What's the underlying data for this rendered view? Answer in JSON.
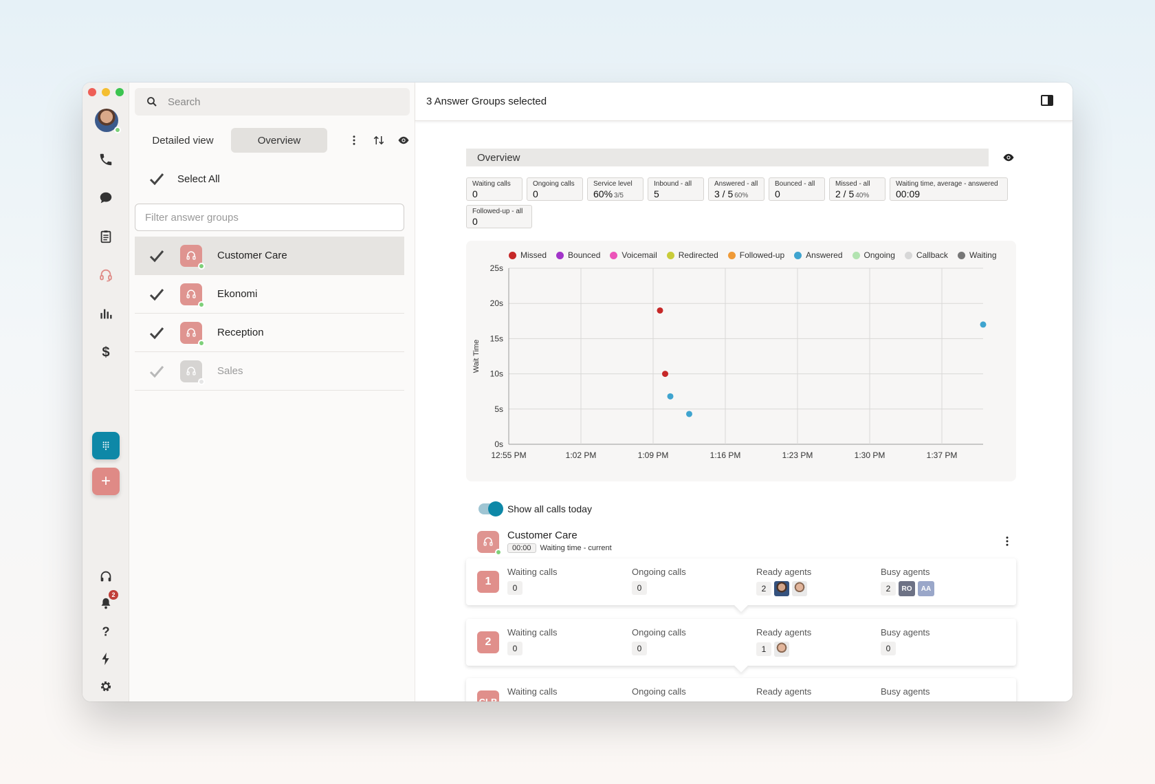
{
  "colors": {
    "red": "#ee5f56",
    "yellow": "#f4be31",
    "green": "#3cc450",
    "teal": "#0e88a7",
    "salmon": "#df9490",
    "missed": "#c62828",
    "bounced": "#a235c9",
    "voicemail": "#ec54b9",
    "redirected": "#c9cc3a",
    "followed_up": "#ef9a37",
    "answered": "#3fa4cf",
    "ongoing": "#b2e3b0",
    "callback": "#d7d7d7",
    "waiting": "#777777"
  },
  "rail": {
    "icons": [
      "phone-icon",
      "chat-icon",
      "clipboard-icon",
      "headset-group-icon",
      "bar-chart-icon",
      "dollar-icon"
    ],
    "dialpad_label": "dialpad-icon",
    "add_label": "+",
    "bottom_icons": [
      "headphones-icon",
      "bell-icon",
      "help-icon",
      "lightning-icon",
      "settings-icon"
    ],
    "notification_count": "2"
  },
  "panel": {
    "search_placeholder": "Search",
    "tabs": [
      {
        "label": "Detailed view"
      },
      {
        "label": "Overview"
      }
    ],
    "select_all": "Select All",
    "filter_placeholder": "Filter answer groups",
    "groups": [
      {
        "name": "Customer Care"
      },
      {
        "name": "Ekonomi"
      },
      {
        "name": "Reception"
      },
      {
        "name": "Sales"
      }
    ]
  },
  "main": {
    "title": "3 Answer Groups selected",
    "overview_title": "Overview",
    "stats": [
      {
        "label": "Waiting calls",
        "value": "0",
        "sub": ""
      },
      {
        "label": "Ongoing calls",
        "value": "0",
        "sub": ""
      },
      {
        "label": "Service level",
        "value": "60%",
        "sub": "3/5"
      },
      {
        "label": "Inbound - all",
        "value": "5",
        "sub": ""
      },
      {
        "label": "Answered - all",
        "value": "3 / 5",
        "sub": "60%"
      },
      {
        "label": "Bounced - all",
        "value": "0",
        "sub": ""
      },
      {
        "label": "Missed - all",
        "value": "2 / 5",
        "sub": "40%"
      },
      {
        "label": "Waiting time, average - answered",
        "value": "00:09",
        "sub": ""
      },
      {
        "label": "Followed-up - all",
        "value": "0",
        "sub": ""
      }
    ],
    "toggle_label": "Show all calls today",
    "group_name": "Customer Care",
    "wait_time": "00:00",
    "wait_label": "Waiting time - current",
    "queue_labels": {
      "waiting": "Waiting calls",
      "ongoing": "Ongoing calls",
      "ready": "Ready agents",
      "busy": "Busy agents"
    },
    "queues": [
      {
        "num": "1",
        "waiting": "0",
        "ongoing": "0",
        "ready": "2",
        "busy": "2",
        "busy_initials": [
          "RO",
          "AA"
        ]
      },
      {
        "num": "2",
        "waiting": "0",
        "ongoing": "0",
        "ready": "1",
        "busy": "0",
        "busy_initials": []
      },
      {
        "num": "CLB",
        "waiting": "",
        "ongoing": "",
        "ready": "",
        "busy": "",
        "busy_initials": []
      }
    ]
  },
  "chart_data": {
    "type": "scatter",
    "title": "",
    "xlabel": "",
    "ylabel": "Wait Time",
    "x_ticks": [
      "12:55 PM",
      "1:02 PM",
      "1:09 PM",
      "1:16 PM",
      "1:23 PM",
      "1:30 PM",
      "1:37 PM"
    ],
    "y_ticks": [
      "0s",
      "5s",
      "10s",
      "15s",
      "20s",
      "25s"
    ],
    "xlim": [
      "12:55",
      "1:41"
    ],
    "ylim": [
      0,
      25
    ],
    "grid": true,
    "legend": [
      "Missed",
      "Bounced",
      "Voicemail",
      "Redirected",
      "Followed-up",
      "Answered",
      "Ongoing",
      "Callback",
      "Waiting"
    ],
    "legend_position": "top",
    "series": [
      {
        "name": "Missed",
        "points": [
          {
            "x": "1:09:40",
            "y": 19
          },
          {
            "x": "1:10:10",
            "y": 10
          }
        ]
      },
      {
        "name": "Answered",
        "points": [
          {
            "x": "1:10:40",
            "y": 6.8
          },
          {
            "x": "1:12:30",
            "y": 4.3
          },
          {
            "x": "1:41:00",
            "y": 17
          }
        ]
      }
    ]
  }
}
